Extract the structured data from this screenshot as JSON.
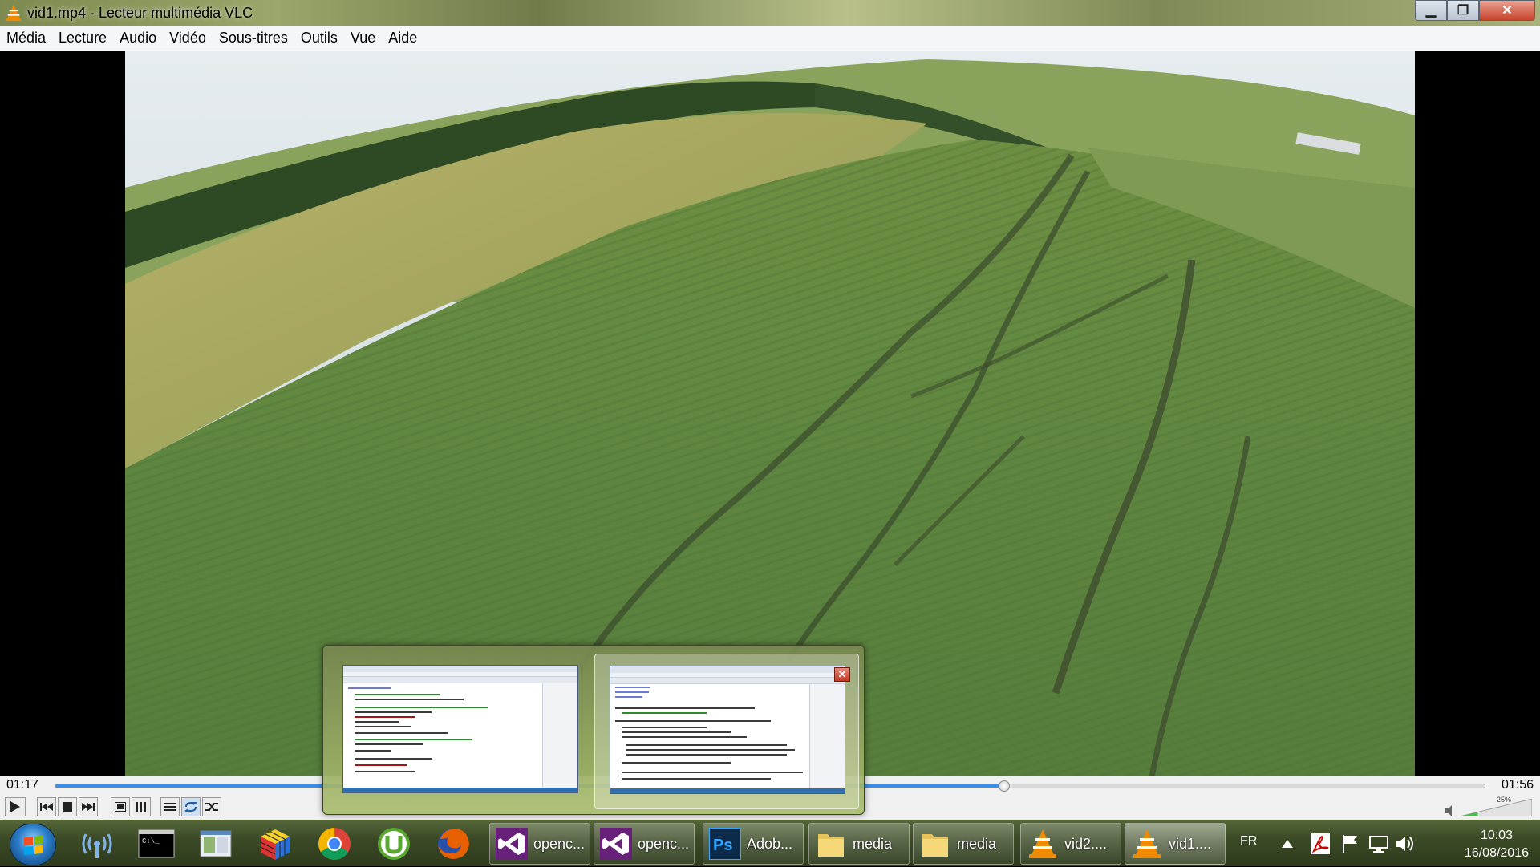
{
  "window": {
    "title": "vid1.mp4 - Lecteur multimédia VLC",
    "minimize": "▁",
    "maximize": "❐",
    "close": "✕"
  },
  "menu": [
    "Média",
    "Lecture",
    "Audio",
    "Vidéo",
    "Sous-titres",
    "Outils",
    "Vue",
    "Aide"
  ],
  "player": {
    "elapsed": "01:17",
    "total": "01:56",
    "progress": 0.664,
    "volume_label": "25%",
    "volume_level": 0.25
  },
  "controls": {
    "play": "play-icon",
    "prev": "previous-icon",
    "stop": "stop-icon",
    "next": "next-icon",
    "fullscreen": "fullscreen-icon",
    "extended": "extended-settings-icon",
    "playlist": "playlist-icon",
    "loop": "loop-icon",
    "random": "shuffle-icon"
  },
  "taskbar": {
    "pinned": [
      "cmd-icon",
      "window-icon",
      "rubik-icon",
      "chrome-icon",
      "utorrent-icon",
      "firefox-icon"
    ],
    "tasks": [
      {
        "label": "openc...",
        "icon": "visual-studio-icon"
      },
      {
        "label": "openc...",
        "icon": "visual-studio-icon"
      },
      {
        "label": "Adob...",
        "icon": "photoshop-icon"
      },
      {
        "label": "media",
        "icon": "folder-icon"
      },
      {
        "label": "media",
        "icon": "folder-icon"
      },
      {
        "label": "vid2....",
        "icon": "vlc-icon"
      },
      {
        "label": "vid1....",
        "icon": "vlc-icon"
      }
    ],
    "language": "FR",
    "time": "10:03",
    "date": "16/08/2016"
  },
  "colors": {
    "progress_fill": "#3a8ee6",
    "taskbar": "#3b4a26",
    "vlc_orange": "#f08a00"
  }
}
